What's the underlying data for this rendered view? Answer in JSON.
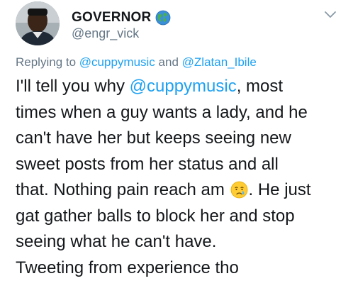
{
  "author": {
    "display_name": "GOVERNOR",
    "handle": "@engr_vick",
    "badge_icon": "globe-icon",
    "avatar_icon": "profile-photo"
  },
  "reply_context": {
    "prefix": "Replying to",
    "mention_1": "@cuppymusic",
    "joiner": "and",
    "mention_2": "@Zlatan_Ibile"
  },
  "tweet": {
    "line1_pre": "I'll tell you why ",
    "line1_mention": "@cuppymusic",
    "line1_post": ", most",
    "line2": "times when a guy wants a lady, and he",
    "line3": "can't have her but keeps seeing new",
    "line4": "sweet posts from her status and all",
    "line5_pre": "that. Nothing pain reach am",
    "line5_emoji": "crying-face-icon",
    "line5_post": ". He just",
    "line6": "gat gather balls to block her and stop",
    "line7": "seeing what he can't have.",
    "line8": "Tweeting from experience tho"
  },
  "controls": {
    "menu_icon": "chevron-down-icon"
  },
  "colors": {
    "text": "#14171a",
    "secondary": "#657786",
    "link": "#1da1f2"
  }
}
